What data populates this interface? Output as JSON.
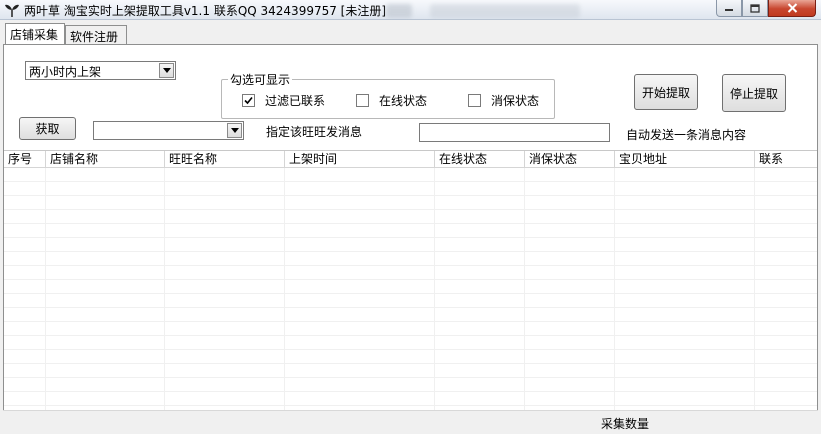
{
  "window": {
    "title": "两叶草 淘宝实时上架提取工具v1.1 联系QQ 3424399757 [未注册]"
  },
  "tabs": [
    {
      "label": "店铺采集",
      "active": true
    },
    {
      "label": "软件注册",
      "active": false
    }
  ],
  "shelf_time_select": {
    "value": "两小时内上架"
  },
  "filter_group": {
    "title": "勾选可显示",
    "options": [
      {
        "label": "过滤已联系",
        "checked": true
      },
      {
        "label": "在线状态",
        "checked": false
      },
      {
        "label": "消保状态",
        "checked": false
      }
    ]
  },
  "buttons": {
    "start": "开始提取",
    "stop": "停止提取",
    "fetch": "获取"
  },
  "wangwang_select": {
    "value": ""
  },
  "labels": {
    "send_to_wangwang": "指定该旺旺发消息",
    "auto_send": "自动发送一条消息内容"
  },
  "message_input": {
    "value": ""
  },
  "table": {
    "columns": [
      "序号",
      "店铺名称",
      "旺旺名称",
      "上架时间",
      "在线状态",
      "消保状态",
      "宝贝地址",
      "联系"
    ],
    "rows": []
  },
  "status": {
    "label": "采集数量"
  },
  "colors": {
    "close_button": "#c8462f",
    "titlebar": "#dfe6ef"
  }
}
